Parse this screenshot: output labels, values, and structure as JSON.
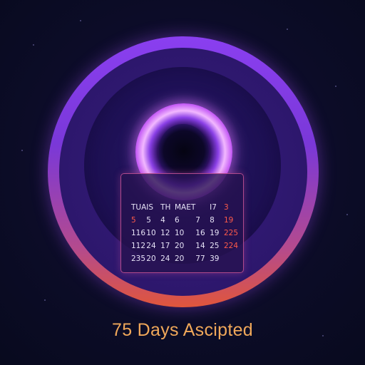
{
  "calendar": {
    "rows": [
      [
        {
          "text": "TUA",
          "red": false
        },
        {
          "text": "IS",
          "red": false
        },
        {
          "text": "TH",
          "red": false
        },
        {
          "text": "MAET",
          "red": false
        },
        {
          "text": "",
          "red": false
        },
        {
          "text": "I7",
          "red": false
        },
        {
          "text": "3",
          "red": true
        }
      ],
      [
        {
          "text": "5",
          "red": true
        },
        {
          "text": "5",
          "red": false
        },
        {
          "text": "4",
          "red": false
        },
        {
          "text": "6",
          "red": false
        },
        {
          "text": "7",
          "red": false
        },
        {
          "text": "8",
          "red": false
        },
        {
          "text": "19",
          "red": true
        }
      ],
      [
        {
          "text": "116",
          "red": false
        },
        {
          "text": "10",
          "red": false
        },
        {
          "text": "12",
          "red": false
        },
        {
          "text": "10",
          "red": false
        },
        {
          "text": "16",
          "red": false
        },
        {
          "text": "19",
          "red": false
        },
        {
          "text": "225",
          "red": true
        }
      ],
      [
        {
          "text": "112",
          "red": false
        },
        {
          "text": "24",
          "red": false
        },
        {
          "text": "17",
          "red": false
        },
        {
          "text": "20",
          "red": false
        },
        {
          "text": "14",
          "red": false
        },
        {
          "text": "25",
          "red": false
        },
        {
          "text": "224",
          "red": true
        }
      ],
      [
        {
          "text": "235",
          "red": false
        },
        {
          "text": "20",
          "red": false
        },
        {
          "text": "24",
          "red": false
        },
        {
          "text": "20",
          "red": false
        },
        {
          "text": "77",
          "red": false
        },
        {
          "text": "39",
          "red": false
        },
        {
          "text": "",
          "red": false
        }
      ]
    ]
  },
  "caption": "75 Days Ascipted",
  "colors": {
    "background": "#090a20",
    "ring_top": "#8a3ff0",
    "ring_bottom": "#e0563c",
    "portal_glow": "#d46cff",
    "calendar_border": "#b04a8c",
    "highlight_red": "#ff5a4a",
    "caption": "#f0a85a"
  }
}
